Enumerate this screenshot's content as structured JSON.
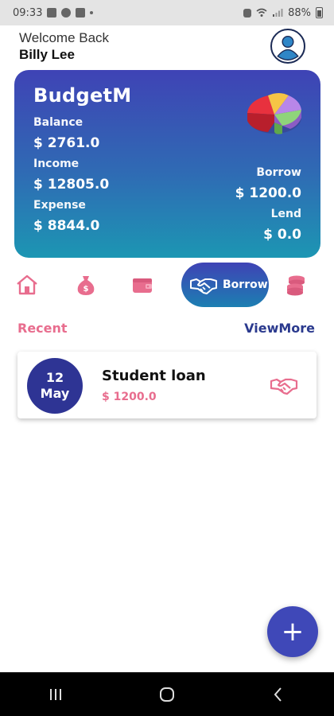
{
  "status_bar": {
    "time": "09:33",
    "battery": "88%",
    "icons": [
      "gallery-icon",
      "whatsapp-icon",
      "facebook-icon",
      "dot-icon",
      "alarm-icon",
      "wifi-icon",
      "signal-icon",
      "battery-icon"
    ]
  },
  "header": {
    "welcome": "Welcome Back",
    "username": "Billy Lee"
  },
  "card": {
    "title": "BudgetM",
    "balance_label": "Balance",
    "balance_value": "$ 2761.0",
    "income_label": "Income",
    "income_value": "$ 12805.0",
    "expense_label": "Expense",
    "expense_value": "$ 8844.0",
    "borrow_label": "Borrow",
    "borrow_value": "$ 1200.0",
    "lend_label": "Lend",
    "lend_value": "$ 0.0"
  },
  "nav": {
    "items": [
      "home-icon",
      "money-bag-icon",
      "wallet-icon",
      "handshake-icon",
      "coins-icon"
    ],
    "active_label": "Borrow"
  },
  "recent": {
    "title": "Recent",
    "view_more": "ViewMore"
  },
  "transactions": [
    {
      "day": "12",
      "month": "May",
      "title": "Student loan",
      "amount": "$ 1200.0",
      "icon": "handshake-icon"
    }
  ],
  "fab": {
    "label": "+"
  },
  "colors": {
    "primary": "#3f43b5",
    "accent": "#e86d8e",
    "dark_blue": "#2e3494"
  }
}
